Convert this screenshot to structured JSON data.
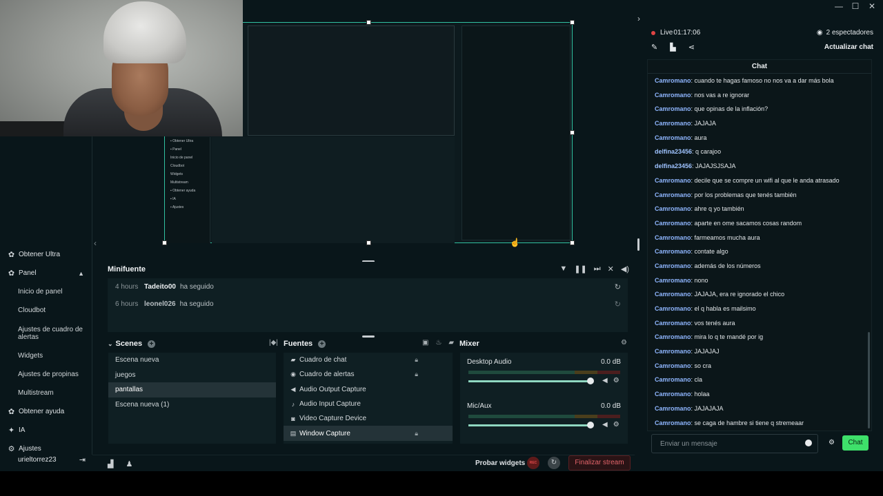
{
  "window": {
    "minimize": "—",
    "maximize": "☐",
    "close": "✕"
  },
  "sidebar": {
    "items": [
      {
        "icon": "ultra-icon",
        "label": "Obtener Ultra"
      },
      {
        "icon": "panel-icon",
        "label": "Panel"
      },
      {
        "label": "Inicio de panel"
      },
      {
        "label": "Cloudbot"
      },
      {
        "label": "Ajustes de cuadro de alertas"
      },
      {
        "label": "Widgets"
      },
      {
        "label": "Ajustes de propinas"
      },
      {
        "label": "Multistream"
      },
      {
        "icon": "help-icon",
        "label": "Obtener ayuda"
      },
      {
        "icon": "ai-icon",
        "label": "IA"
      },
      {
        "icon": "gear-icon",
        "label": "Ajustes"
      }
    ],
    "username": "urieltorrez23"
  },
  "minifuente": {
    "title": "Minifuente",
    "events": [
      {
        "time": "4 hours",
        "user": "Tadeito00",
        "action": "ha seguido"
      },
      {
        "time": "6 hours",
        "user": "leonel026",
        "action": "ha seguido"
      }
    ]
  },
  "scenes": {
    "title": "Scenes",
    "items": [
      "Escena nueva",
      "juegos",
      "pantallas",
      "Escena nueva (1)"
    ],
    "active": "pantallas"
  },
  "sources": {
    "title": "Fuentes",
    "items": [
      {
        "icon": "chat-icon",
        "label": "Cuadro de chat"
      },
      {
        "icon": "alert-icon",
        "label": "Cuadro de alertas"
      },
      {
        "icon": "speaker-icon",
        "label": "Audio Output Capture"
      },
      {
        "icon": "mic-icon",
        "label": "Audio Input Capture"
      },
      {
        "icon": "camera-icon",
        "label": "Video Capture Device"
      },
      {
        "icon": "window-icon",
        "label": "Window Capture"
      }
    ]
  },
  "mixer": {
    "title": "Mixer",
    "channels": [
      {
        "name": "Desktop Audio",
        "db": "0.0 dB",
        "level": 1.0
      },
      {
        "name": "Mic/Aux",
        "db": "0.0 dB",
        "level": 1.0
      }
    ]
  },
  "footer": {
    "probar": "Probar widgets",
    "rec": "REC",
    "end": "Finalizar stream"
  },
  "stream": {
    "live": "Live",
    "time": "01:17:06",
    "viewers": "2 espectadores",
    "refresh": "Actualizar chat"
  },
  "chat": {
    "title": "Chat",
    "messages": [
      {
        "user": "Camromano",
        "color": "#8fb6ff",
        "text": "cuando te hagas famoso no nos va a dar más bola"
      },
      {
        "user": "Camromano",
        "color": "#8fb6ff",
        "text": "nos vas a re ignorar"
      },
      {
        "user": "Camromano",
        "color": "#8fb6ff",
        "text": "que opinas de la inflación?"
      },
      {
        "user": "Camromano",
        "color": "#8fb6ff",
        "text": "JAJAJA"
      },
      {
        "user": "Camromano",
        "color": "#8fb6ff",
        "text": "aura"
      },
      {
        "user": "delfina23456",
        "color": "#9fc3ff",
        "text": "q carajoo"
      },
      {
        "user": "delfina23456",
        "color": "#9fc3ff",
        "text": "JAJAJSJSAJA"
      },
      {
        "user": "Camromano",
        "color": "#8fb6ff",
        "text": "decile que se compre un wifi al que le anda atrasado"
      },
      {
        "user": "Camromano",
        "color": "#8fb6ff",
        "text": "por los problemas que tenés también"
      },
      {
        "user": "Camromano",
        "color": "#8fb6ff",
        "text": "ahre q yo también"
      },
      {
        "user": "Camromano",
        "color": "#8fb6ff",
        "text": "aparte en ome sacamos cosas random"
      },
      {
        "user": "Camromano",
        "color": "#8fb6ff",
        "text": "farmeamos mucha aura"
      },
      {
        "user": "Camromano",
        "color": "#8fb6ff",
        "text": "contate algo"
      },
      {
        "user": "Camromano",
        "color": "#8fb6ff",
        "text": "además de los números"
      },
      {
        "user": "Camromano",
        "color": "#8fb6ff",
        "text": "nono"
      },
      {
        "user": "Camromano",
        "color": "#8fb6ff",
        "text": "JAJAJA, era re ignorado el chico"
      },
      {
        "user": "Camromano",
        "color": "#8fb6ff",
        "text": "el q habla es mailsimo"
      },
      {
        "user": "Camromano",
        "color": "#8fb6ff",
        "text": "vos tenés aura"
      },
      {
        "user": "Camromano",
        "color": "#8fb6ff",
        "text": "mira lo q te mandé por ig"
      },
      {
        "user": "Camromano",
        "color": "#8fb6ff",
        "text": "JAJAJAJ"
      },
      {
        "user": "Camromano",
        "color": "#8fb6ff",
        "text": "so cra"
      },
      {
        "user": "Camromano",
        "color": "#8fb6ff",
        "text": "cla"
      },
      {
        "user": "Camromano",
        "color": "#8fb6ff",
        "text": "holaa"
      },
      {
        "user": "Camromano",
        "color": "#8fb6ff",
        "text": "JAJAJAJA"
      },
      {
        "user": "Camromano",
        "color": "#8fb6ff",
        "text": "se caga de hambre si tiene q stremeaar"
      }
    ],
    "input_placeholder": "Enviar un mensaje",
    "send": "Chat"
  },
  "colors": {
    "accent": "#31c3a2",
    "live": "#e04444",
    "send": "#3ee06a",
    "end_stream": "#e3646a"
  }
}
